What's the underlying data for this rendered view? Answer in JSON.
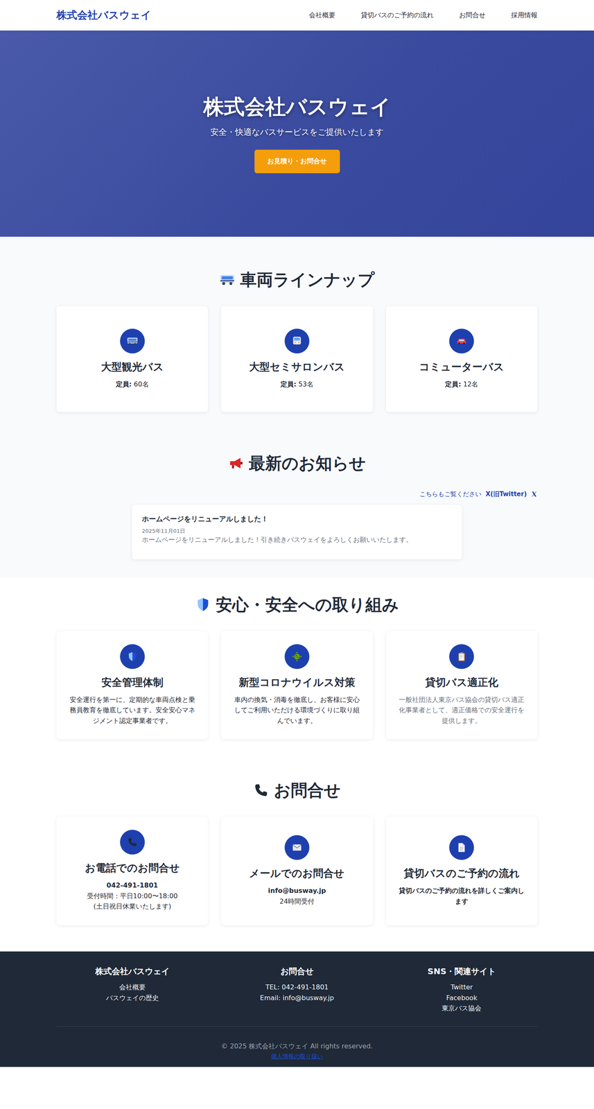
{
  "nav": {
    "brand": "株式会社バスウェイ",
    "items": [
      "会社概要",
      "貸切バスのご予約の流れ",
      "お問合せ",
      "採用情報"
    ]
  },
  "hero": {
    "title": "株式会社バスウェイ",
    "subtitle": "安全・快適なバスサービスをご提供いたします",
    "button": "お見積り・お問合せ"
  },
  "vehicles": {
    "title": "車両ラインナップ",
    "items": [
      {
        "name": "大型観光バス",
        "label": "定員:",
        "capacity": "60名"
      },
      {
        "name": "大型セミサロンバス",
        "label": "定員:",
        "capacity": "53名"
      },
      {
        "name": "コミューターバス",
        "label": "定員:",
        "capacity": "12名"
      }
    ]
  },
  "news": {
    "title": "最新のお知らせ",
    "follow": "こちらもご覧ください",
    "follow_link": "X(旧Twitter)",
    "posts": [
      {
        "title": "ホームページをリニューアルしました！",
        "date": "2025年11月01日",
        "body": "ホームページをリニューアルしました！引き続きバスウェイをよろしくお願いいたします。"
      }
    ]
  },
  "safety": {
    "title": "安心・安全への取り組み",
    "items": [
      {
        "title": "安全管理体制",
        "text": "安全運行を第一に、定期的な車両点検と乗務員教育を徹底しています。安全安心マネジメント認定事業者です。",
        "muted": false
      },
      {
        "title": "新型コロナウイルス対策",
        "text": "車内の換気・消毒を徹底し、お客様に安心してご利用いただける環境づくりに取り組んでいます。",
        "muted": false
      },
      {
        "title": "貸切バス適正化",
        "text": "一般社団法人東京バス協会の貸切バス適正化事業者として、適正価格での安全運行を提供します。",
        "muted": true
      }
    ]
  },
  "contact": {
    "title": "お問合せ",
    "items": [
      {
        "title": "お電話でのお問合せ",
        "lines": [
          {
            "text": "042-491-1801",
            "strong": true
          },
          {
            "text": "受付時間：平日10:00〜18:00",
            "strong": false
          },
          {
            "text": "(土日祝日休業いたします)",
            "strong": false
          }
        ]
      },
      {
        "title": "メールでのお問合せ",
        "lines": [
          {
            "text": "info@busway.jp",
            "strong": true
          },
          {
            "text": "24時間受付",
            "strong": false
          }
        ]
      },
      {
        "title": "貸切バスのご予約の流れ",
        "lines": [
          {
            "text": "貸切バスのご予約の流れを詳しくご案内します",
            "strong": true
          }
        ]
      }
    ]
  },
  "footer": {
    "columns": [
      {
        "title": "株式会社バスウェイ",
        "links": [
          "会社概要",
          "バスウェイの歴史"
        ]
      },
      {
        "title": "お問合せ",
        "links": [
          "TEL: 042-491-1801",
          "Email: info@busway.jp"
        ]
      },
      {
        "title": "SNS・関連サイト",
        "links": [
          "Twitter",
          "Facebook",
          "東京バス協会"
        ]
      }
    ],
    "copyright": "© 2025 株式会社バスウェイ All rights reserved.",
    "privacy": "個人情報の取り扱い"
  }
}
